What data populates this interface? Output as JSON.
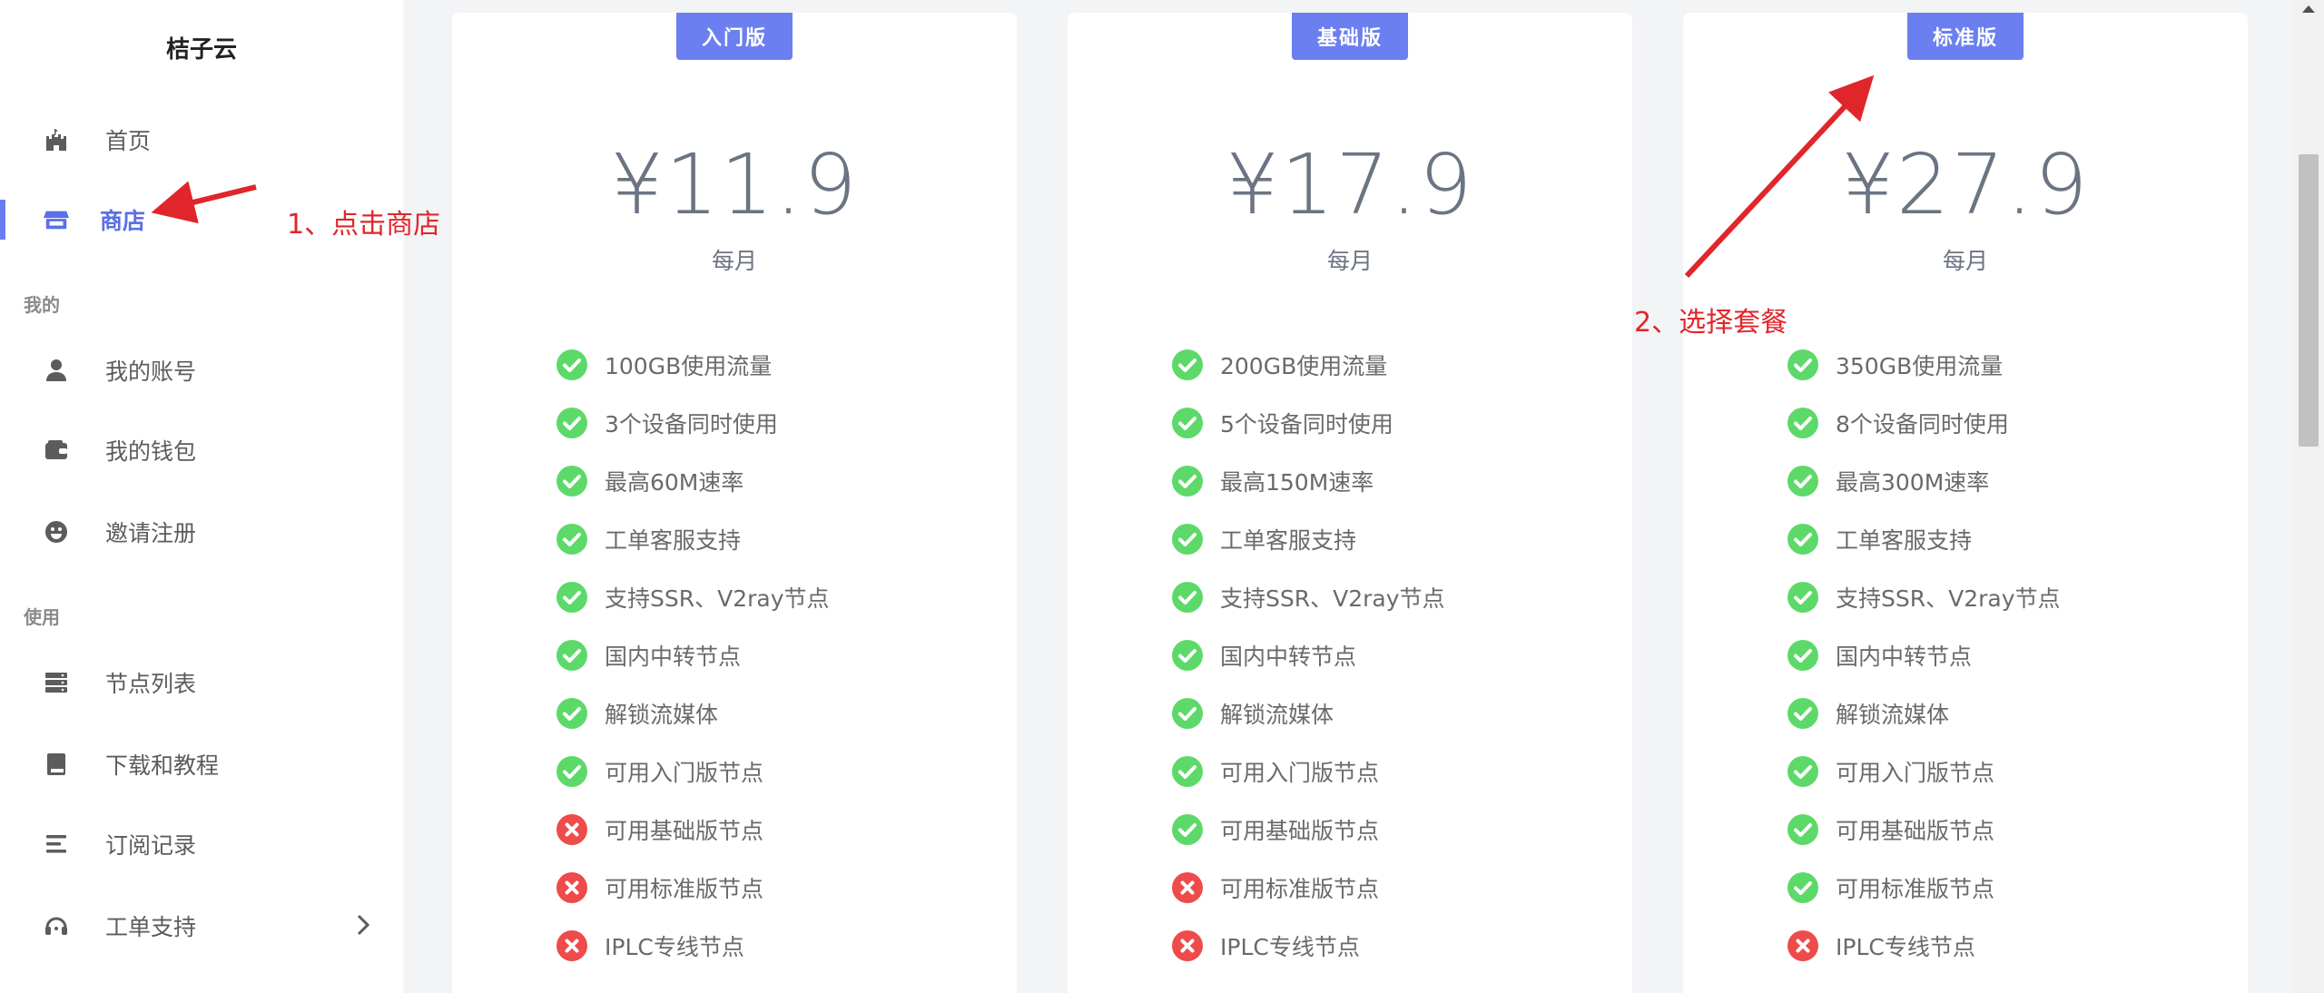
{
  "app": {
    "brand": "桔子云"
  },
  "sidebar": {
    "items": [
      {
        "label": "首页",
        "icon": "castle-icon"
      },
      {
        "label": "商店",
        "icon": "store-icon",
        "active": true
      },
      {
        "label": "我的账号",
        "icon": "user-icon"
      },
      {
        "label": "我的钱包",
        "icon": "wallet-icon"
      },
      {
        "label": "邀请注册",
        "icon": "smile-icon"
      },
      {
        "label": "节点列表",
        "icon": "server-icon"
      },
      {
        "label": "下载和教程",
        "icon": "book-icon"
      },
      {
        "label": "订阅记录",
        "icon": "list-icon"
      },
      {
        "label": "工单支持",
        "icon": "headset-icon"
      }
    ],
    "sections": {
      "mine": "我的",
      "use": "使用"
    }
  },
  "plans": [
    {
      "badge": "入门版",
      "price": "¥11.9",
      "period": "每月",
      "features": [
        {
          "text": "100GB使用流量",
          "ok": true
        },
        {
          "text": "3个设备同时使用",
          "ok": true
        },
        {
          "text": "最高60M速率",
          "ok": true
        },
        {
          "text": "工单客服支持",
          "ok": true
        },
        {
          "text": "支持SSR、V2ray节点",
          "ok": true
        },
        {
          "text": "国内中转节点",
          "ok": true
        },
        {
          "text": "解锁流媒体",
          "ok": true
        },
        {
          "text": "可用入门版节点",
          "ok": true
        },
        {
          "text": "可用基础版节点",
          "ok": false
        },
        {
          "text": "可用标准版节点",
          "ok": false
        },
        {
          "text": "IPLC专线节点",
          "ok": false
        }
      ]
    },
    {
      "badge": "基础版",
      "price": "¥17.9",
      "period": "每月",
      "features": [
        {
          "text": "200GB使用流量",
          "ok": true
        },
        {
          "text": "5个设备同时使用",
          "ok": true
        },
        {
          "text": "最高150M速率",
          "ok": true
        },
        {
          "text": "工单客服支持",
          "ok": true
        },
        {
          "text": "支持SSR、V2ray节点",
          "ok": true
        },
        {
          "text": "国内中转节点",
          "ok": true
        },
        {
          "text": "解锁流媒体",
          "ok": true
        },
        {
          "text": "可用入门版节点",
          "ok": true
        },
        {
          "text": "可用基础版节点",
          "ok": true
        },
        {
          "text": "可用标准版节点",
          "ok": false
        },
        {
          "text": "IPLC专线节点",
          "ok": false
        }
      ]
    },
    {
      "badge": "标准版",
      "price": "¥27.9",
      "period": "每月",
      "features": [
        {
          "text": "350GB使用流量",
          "ok": true
        },
        {
          "text": "8个设备同时使用",
          "ok": true
        },
        {
          "text": "最高300M速率",
          "ok": true
        },
        {
          "text": "工单客服支持",
          "ok": true
        },
        {
          "text": "支持SSR、V2ray节点",
          "ok": true
        },
        {
          "text": "国内中转节点",
          "ok": true
        },
        {
          "text": "解锁流媒体",
          "ok": true
        },
        {
          "text": "可用入门版节点",
          "ok": true
        },
        {
          "text": "可用基础版节点",
          "ok": true
        },
        {
          "text": "可用标准版节点",
          "ok": true
        },
        {
          "text": "IPLC专线节点",
          "ok": false
        }
      ]
    }
  ],
  "annotations": {
    "step1": "1、点击商店",
    "step2": "2、选择套餐",
    "color": "#e0262b"
  },
  "colors": {
    "accent": "#6b7ff0",
    "check": "#5dd96a",
    "cross": "#ee4b4b"
  }
}
